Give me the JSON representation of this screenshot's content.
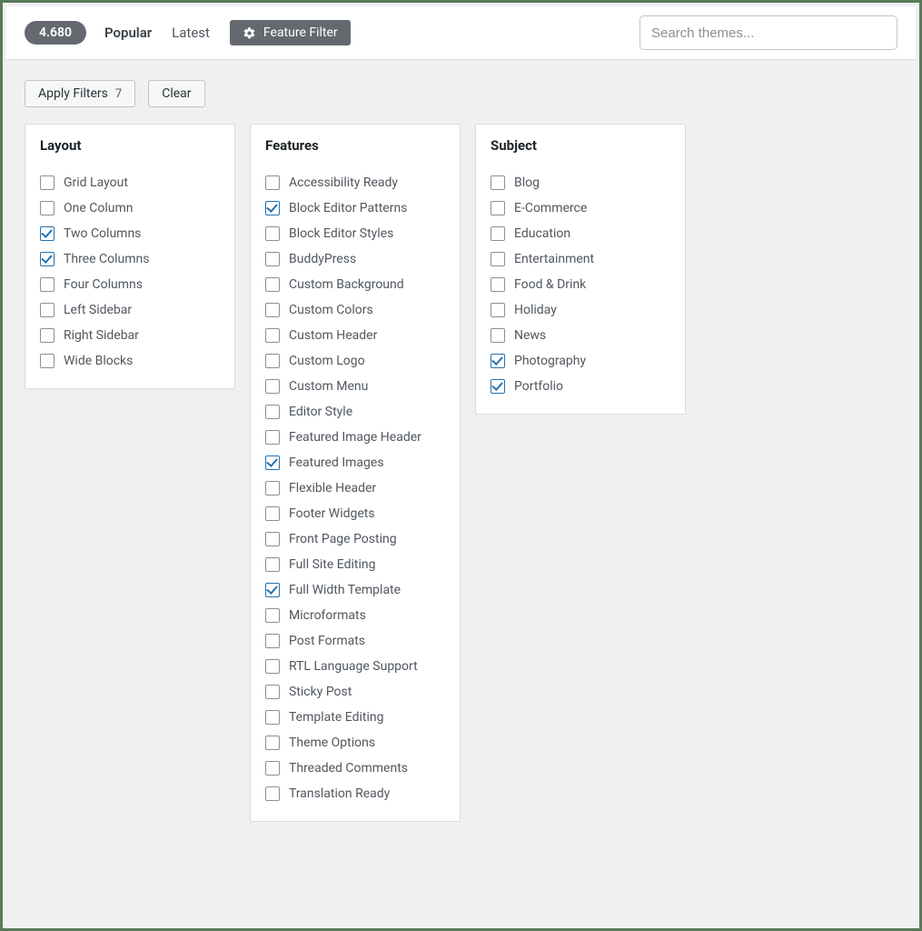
{
  "topbar": {
    "count": "4.680",
    "tab_popular": "Popular",
    "tab_latest": "Latest",
    "feature_filter": "Feature Filter",
    "search_placeholder": "Search themes..."
  },
  "actions": {
    "apply_label": "Apply Filters",
    "apply_count": "7",
    "clear_label": "Clear"
  },
  "panels": {
    "layout": {
      "title": "Layout",
      "items": [
        {
          "label": "Grid Layout",
          "checked": false
        },
        {
          "label": "One Column",
          "checked": false
        },
        {
          "label": "Two Columns",
          "checked": true
        },
        {
          "label": "Three Columns",
          "checked": true
        },
        {
          "label": "Four Columns",
          "checked": false
        },
        {
          "label": "Left Sidebar",
          "checked": false
        },
        {
          "label": "Right Sidebar",
          "checked": false
        },
        {
          "label": "Wide Blocks",
          "checked": false
        }
      ]
    },
    "features": {
      "title": "Features",
      "items": [
        {
          "label": "Accessibility Ready",
          "checked": false
        },
        {
          "label": "Block Editor Patterns",
          "checked": true
        },
        {
          "label": "Block Editor Styles",
          "checked": false
        },
        {
          "label": "BuddyPress",
          "checked": false
        },
        {
          "label": "Custom Background",
          "checked": false
        },
        {
          "label": "Custom Colors",
          "checked": false
        },
        {
          "label": "Custom Header",
          "checked": false
        },
        {
          "label": "Custom Logo",
          "checked": false
        },
        {
          "label": "Custom Menu",
          "checked": false
        },
        {
          "label": "Editor Style",
          "checked": false
        },
        {
          "label": "Featured Image Header",
          "checked": false
        },
        {
          "label": "Featured Images",
          "checked": true
        },
        {
          "label": "Flexible Header",
          "checked": false
        },
        {
          "label": "Footer Widgets",
          "checked": false
        },
        {
          "label": "Front Page Posting",
          "checked": false
        },
        {
          "label": "Full Site Editing",
          "checked": false
        },
        {
          "label": "Full Width Template",
          "checked": true
        },
        {
          "label": "Microformats",
          "checked": false
        },
        {
          "label": "Post Formats",
          "checked": false
        },
        {
          "label": "RTL Language Support",
          "checked": false
        },
        {
          "label": "Sticky Post",
          "checked": false
        },
        {
          "label": "Template Editing",
          "checked": false
        },
        {
          "label": "Theme Options",
          "checked": false
        },
        {
          "label": "Threaded Comments",
          "checked": false
        },
        {
          "label": "Translation Ready",
          "checked": false
        }
      ]
    },
    "subject": {
      "title": "Subject",
      "items": [
        {
          "label": "Blog",
          "checked": false
        },
        {
          "label": "E-Commerce",
          "checked": false
        },
        {
          "label": "Education",
          "checked": false
        },
        {
          "label": "Entertainment",
          "checked": false
        },
        {
          "label": "Food & Drink",
          "checked": false
        },
        {
          "label": "Holiday",
          "checked": false
        },
        {
          "label": "News",
          "checked": false
        },
        {
          "label": "Photography",
          "checked": true
        },
        {
          "label": "Portfolio",
          "checked": true
        }
      ]
    }
  }
}
